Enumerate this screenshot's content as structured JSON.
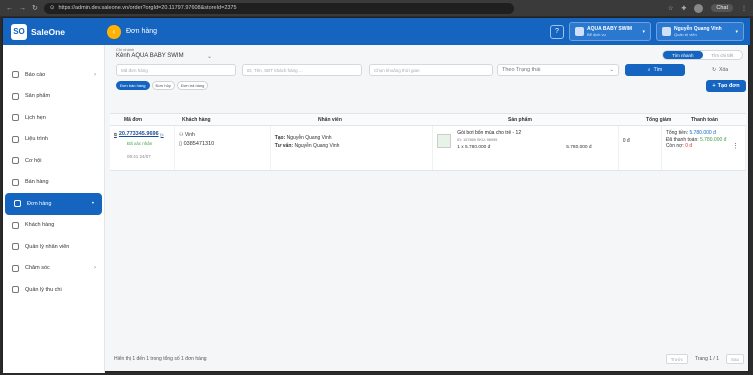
{
  "browser": {
    "url": "https://admin.dev.saleone.vn/order?orgId=20.11797.97608&storeId=2375",
    "chat": "Chat"
  },
  "topbar": {
    "brand": "SaleOne",
    "logo": "SO",
    "page_title": "Đơn hàng",
    "store_name": "AQUA BABY SWIM",
    "store_sub": "Bể dịch vụ",
    "user_name": "Nguyễn Quang Vinh",
    "user_sub": "Quản trị viên"
  },
  "sidebar": {
    "items": [
      {
        "label": "Báo cáo",
        "icon": "chart-icon"
      },
      {
        "label": "Sản phẩm",
        "icon": "box-icon"
      },
      {
        "label": "Lịch hẹn",
        "icon": "calendar-icon"
      },
      {
        "label": "Liệu trình",
        "icon": "clipboard-icon"
      },
      {
        "label": "Cơ hội",
        "icon": "target-icon"
      },
      {
        "label": "Bán hàng",
        "icon": "cart-icon"
      },
      {
        "label": "Đơn hàng",
        "icon": "receipt-icon"
      },
      {
        "label": "Khách hàng",
        "icon": "user-icon"
      },
      {
        "label": "Quản lý nhân viên",
        "icon": "users-icon"
      },
      {
        "label": "Chăm sóc",
        "icon": "heart-icon"
      },
      {
        "label": "Quản lý thu chi",
        "icon": "wallet-icon"
      }
    ]
  },
  "filters": {
    "branch_label": "Chi nhánh",
    "branch_value": "Kênh AQUA BABY SWIM",
    "view_fast": "Tìm nhanh",
    "view_detail": "Tìm chi tiết",
    "order_code_ph": "Mã đơn hàng",
    "customer_ph": "ID, Tên, SĐT khách hàng ...",
    "time_ph": "Chọn khoảng thời gian",
    "status_ph": "Theo Trạng thái",
    "search_label": "Tìm",
    "reset_label": "Xóa"
  },
  "tabs": [
    "Đơn bán hàng",
    "Đơn hủy",
    "Đơn trả hàng"
  ],
  "create_label": "Tạo đơn",
  "table": {
    "headers": [
      "Mã đơn",
      "Khách hàng",
      "Nhân viên",
      "Sản phẩm",
      "Tổng giảm",
      "Thanh toán"
    ],
    "rows": [
      {
        "code": "20.773345.9696",
        "status": "Đã xác nhận",
        "time": "09:41 24/07",
        "customer_name": "Vinh",
        "customer_phone": "0385471310",
        "staff_created_label": "Tạo:",
        "staff_created": "Nguyễn Quang Vinh",
        "staff_advisor_label": "Tư vấn:",
        "staff_advisor": "Nguyễn Quang Vinh",
        "product_name": "Gói bơi bốn mùa cho trẻ - 12",
        "product_id": "ID: 157869    SKU: 96995",
        "product_qty": "1   x   5.780.000 đ",
        "product_total": "5.780.000 đ",
        "discount": "0 đ",
        "pay_total_label": "Tổng tiền:",
        "pay_total": "5.780.000 đ",
        "pay_paid_label": "Đã thanh toán:",
        "pay_paid": "5.780.000 đ",
        "pay_due_label": "Còn nợ:",
        "pay_due": "0 đ"
      }
    ]
  },
  "footer": {
    "info": "Hiển thị 1 đến 1 trong tổng số 1 đơn hàng",
    "prev": "Trước",
    "page": "Trang 1 / 1",
    "next": "Sau"
  }
}
